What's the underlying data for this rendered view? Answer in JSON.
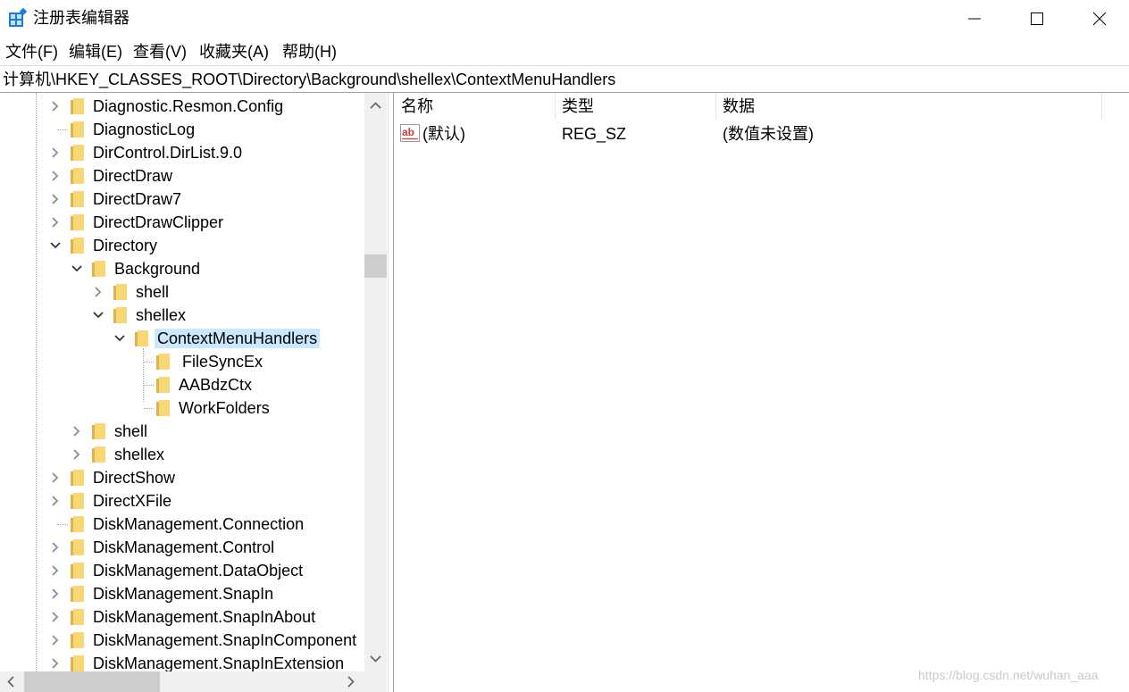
{
  "window": {
    "title": "注册表编辑器",
    "controls": {
      "minimize": "minimize",
      "maximize": "maximize",
      "close": "close"
    }
  },
  "menu": [
    "文件(F)",
    "编辑(E)",
    "查看(V)",
    "收藏夹(A)",
    "帮助(H)"
  ],
  "address": "计算机\\HKEY_CLASSES_ROOT\\Directory\\Background\\shellex\\ContextMenuHandlers",
  "tree": [
    {
      "label": "Diagnostic.Resmon.Config",
      "arrow": "collapsed"
    },
    {
      "label": "DiagnosticLog",
      "arrow": "none"
    },
    {
      "label": "DirControl.DirList.9.0",
      "arrow": "collapsed"
    },
    {
      "label": "DirectDraw",
      "arrow": "collapsed"
    },
    {
      "label": "DirectDraw7",
      "arrow": "collapsed"
    },
    {
      "label": "DirectDrawClipper",
      "arrow": "collapsed"
    },
    {
      "label": "Directory",
      "arrow": "expanded"
    },
    {
      "label": "Background",
      "arrow": "expanded"
    },
    {
      "label": "shell",
      "arrow": "collapsed"
    },
    {
      "label": "shellex",
      "arrow": "expanded"
    },
    {
      "label": "ContextMenuHandlers",
      "arrow": "expanded",
      "selected": true
    },
    {
      "label": " FileSyncEx",
      "arrow": "none"
    },
    {
      "label": "AABdzCtx",
      "arrow": "none"
    },
    {
      "label": "WorkFolders",
      "arrow": "none"
    },
    {
      "label": "shell",
      "arrow": "collapsed"
    },
    {
      "label": "shellex",
      "arrow": "collapsed"
    },
    {
      "label": "DirectShow",
      "arrow": "collapsed"
    },
    {
      "label": "DirectXFile",
      "arrow": "collapsed"
    },
    {
      "label": "DiskManagement.Connection",
      "arrow": "none"
    },
    {
      "label": "DiskManagement.Control",
      "arrow": "collapsed"
    },
    {
      "label": "DiskManagement.DataObject",
      "arrow": "collapsed"
    },
    {
      "label": "DiskManagement.SnapIn",
      "arrow": "collapsed"
    },
    {
      "label": "DiskManagement.SnapInAbout",
      "arrow": "collapsed"
    },
    {
      "label": "DiskManagement.SnapInComponent",
      "arrow": "collapsed"
    },
    {
      "label": "DiskManagement.SnapInExtension",
      "arrow": "collapsed"
    }
  ],
  "columns": [
    "名称",
    "类型",
    "数据"
  ],
  "values": [
    {
      "name": "(默认)",
      "type": "REG_SZ",
      "data": "(数值未设置)",
      "icon": "string-value-icon"
    }
  ],
  "watermark": "https://blog.csdn.net/wuhan_aaa",
  "colors": {
    "selection": "#cce8ff",
    "folder": "#f8d775",
    "folder_dark": "#e0b04c",
    "icon_red": "#c9403a"
  }
}
